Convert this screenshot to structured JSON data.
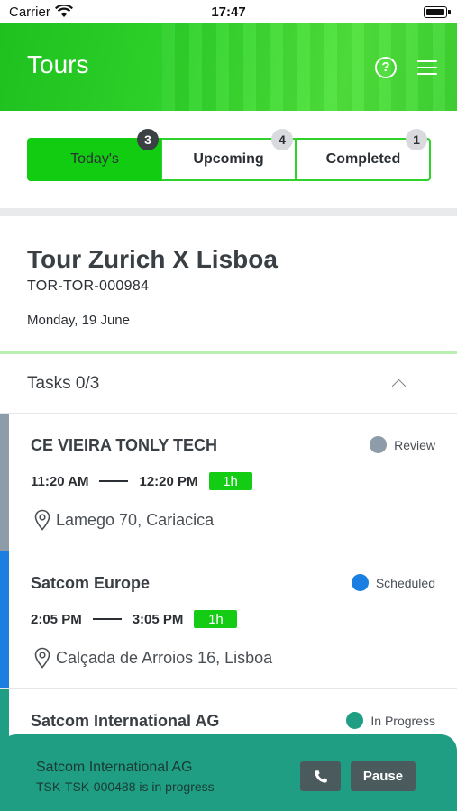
{
  "status_bar": {
    "carrier": "Carrier",
    "time": "17:47"
  },
  "header": {
    "title": "Tours",
    "help_icon": "question-circle-icon",
    "menu_icon": "hamburger-menu-icon"
  },
  "tabs": [
    {
      "label": "Today's",
      "count": "3",
      "active": true
    },
    {
      "label": "Upcoming",
      "count": "4",
      "active": false
    },
    {
      "label": "Completed",
      "count": "1",
      "active": false
    }
  ],
  "tour": {
    "title": "Tour Zurich X Lisboa",
    "code": "TOR-TOR-000984",
    "date": "Monday, 19 June"
  },
  "tasks": {
    "label": "Tasks 0/3",
    "items": [
      {
        "name": "CE VIEIRA TONLY TECH",
        "status": "Review",
        "status_color": "#8d9ca8",
        "stripe_color": "#8d9ca8",
        "start": "11:20 AM",
        "end": "12:20 PM",
        "duration": "1h",
        "address": "Lamego 70, Cariacica"
      },
      {
        "name": "Satcom Europe",
        "status": "Scheduled",
        "status_color": "#1a7fe0",
        "stripe_color": "#1a7fe0",
        "start": "2:05 PM",
        "end": "3:05 PM",
        "duration": "1h",
        "address": "Calçada de Arroios 16, Lisboa"
      },
      {
        "name": "Satcom International AG",
        "status": "In Progress",
        "status_color": "#1f9e84",
        "stripe_color": "#1f9e84",
        "start": "",
        "end": "",
        "duration": "",
        "address": ""
      }
    ]
  },
  "bottom_bar": {
    "title": "Satcom International AG",
    "subtitle": "TSK-TSK-000488 is in progress",
    "call_icon": "phone-icon",
    "pause_label": "Pause",
    "color": "#1f9e84"
  },
  "colors": {
    "brand_green": "#11cc11",
    "badge_dark": "#3b4045"
  }
}
